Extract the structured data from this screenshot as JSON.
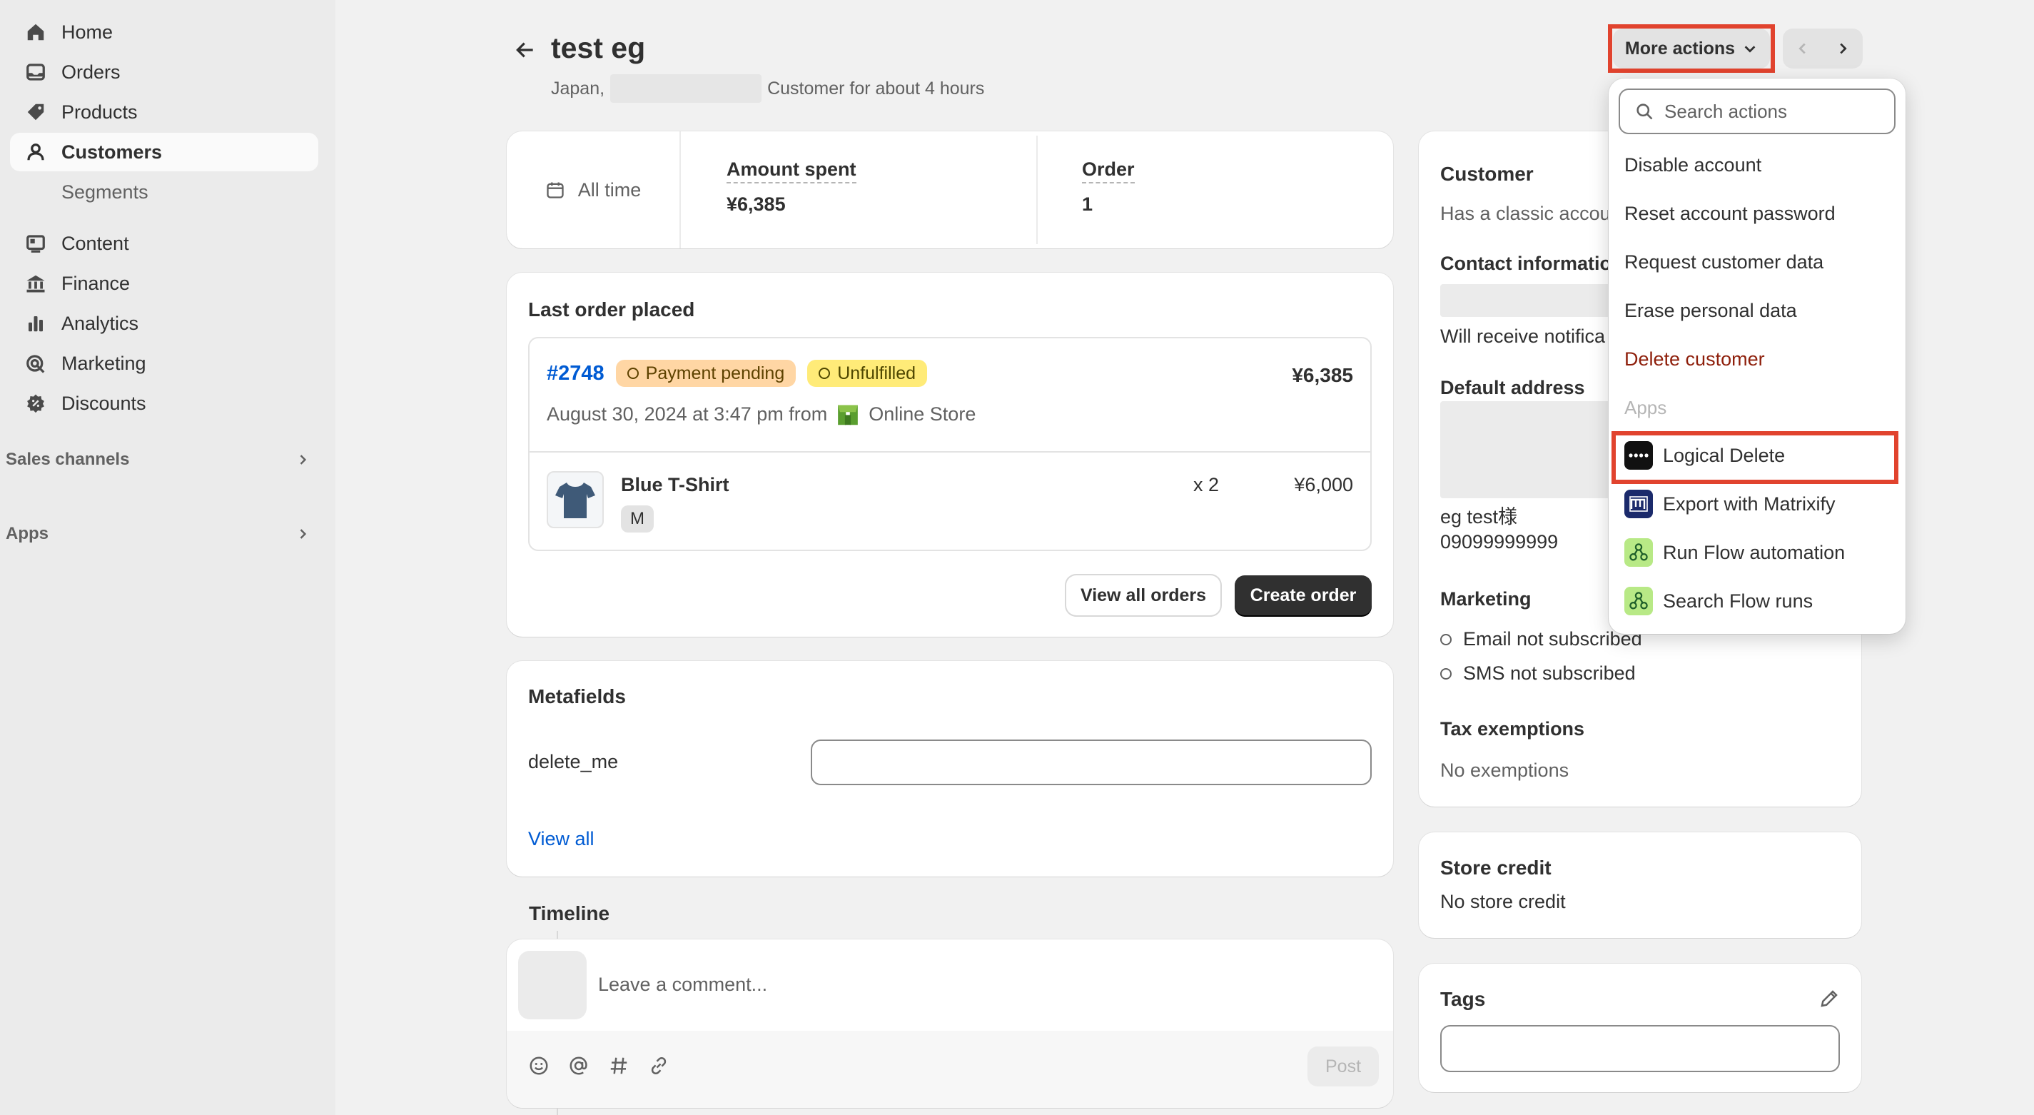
{
  "sidebar": {
    "items": [
      {
        "label": "Home",
        "icon": "home-icon"
      },
      {
        "label": "Orders",
        "icon": "inbox-icon"
      },
      {
        "label": "Products",
        "icon": "tag-icon"
      },
      {
        "label": "Customers",
        "icon": "person-icon"
      },
      {
        "label": "Segments"
      },
      {
        "label": "Content",
        "icon": "content-icon"
      },
      {
        "label": "Finance",
        "icon": "bank-icon"
      },
      {
        "label": "Analytics",
        "icon": "bar-chart-icon"
      },
      {
        "label": "Marketing",
        "icon": "target-icon"
      },
      {
        "label": "Discounts",
        "icon": "discount-icon"
      }
    ],
    "sections": [
      "Sales channels",
      "Apps"
    ]
  },
  "header": {
    "title": "test eg",
    "country": "Japan,",
    "customer_since": "Customer for about 4 hours",
    "more_actions": "More actions"
  },
  "stats": {
    "period": "All time",
    "amount_label": "Amount spent",
    "amount_value": "¥6,385",
    "order_label": "Order",
    "order_value": "1"
  },
  "last_order": {
    "title": "Last order placed",
    "number": "#2748",
    "payment_badge": "Payment pending",
    "fulfillment_badge": "Unfulfilled",
    "total": "¥6,385",
    "date_line": "August 30, 2024 at 3:47 pm from",
    "channel": "Online Store",
    "item_name": "Blue T-Shirt",
    "item_variant": "M",
    "item_qty": "x 2",
    "item_price": "¥6,000",
    "view_all": "View all orders",
    "create": "Create order"
  },
  "metafields": {
    "title": "Metafields",
    "field_label": "delete_me",
    "view_all": "View all"
  },
  "timeline": {
    "title": "Timeline",
    "placeholder": "Leave a comment...",
    "post": "Post"
  },
  "customer_card": {
    "title": "Customer",
    "classic_account": "Has a classic accou",
    "contact_title": "Contact informatio",
    "notifications": "Will receive notifica",
    "address_title": "Default address",
    "address_name": "eg test様",
    "address_phone": "09099999999",
    "marketing_title": "Marketing",
    "email_status": "Email not subscribed",
    "sms_status": "SMS not subscribed",
    "tax_title": "Tax exemptions",
    "tax_value": "No exemptions"
  },
  "store_credit": {
    "title": "Store credit",
    "value": "No store credit"
  },
  "tags": {
    "title": "Tags"
  },
  "actions_menu": {
    "search_placeholder": "Search actions",
    "items": [
      "Disable account",
      "Reset account password",
      "Request customer data",
      "Erase personal data"
    ],
    "danger_item": "Delete customer",
    "apps_heading": "Apps",
    "apps": [
      "Logical Delete",
      "Export with Matrixify",
      "Run Flow automation",
      "Search Flow runs"
    ]
  },
  "colors": {
    "highlight": "#e1432e",
    "link": "#005bd3",
    "danger": "#8e1f0b"
  }
}
